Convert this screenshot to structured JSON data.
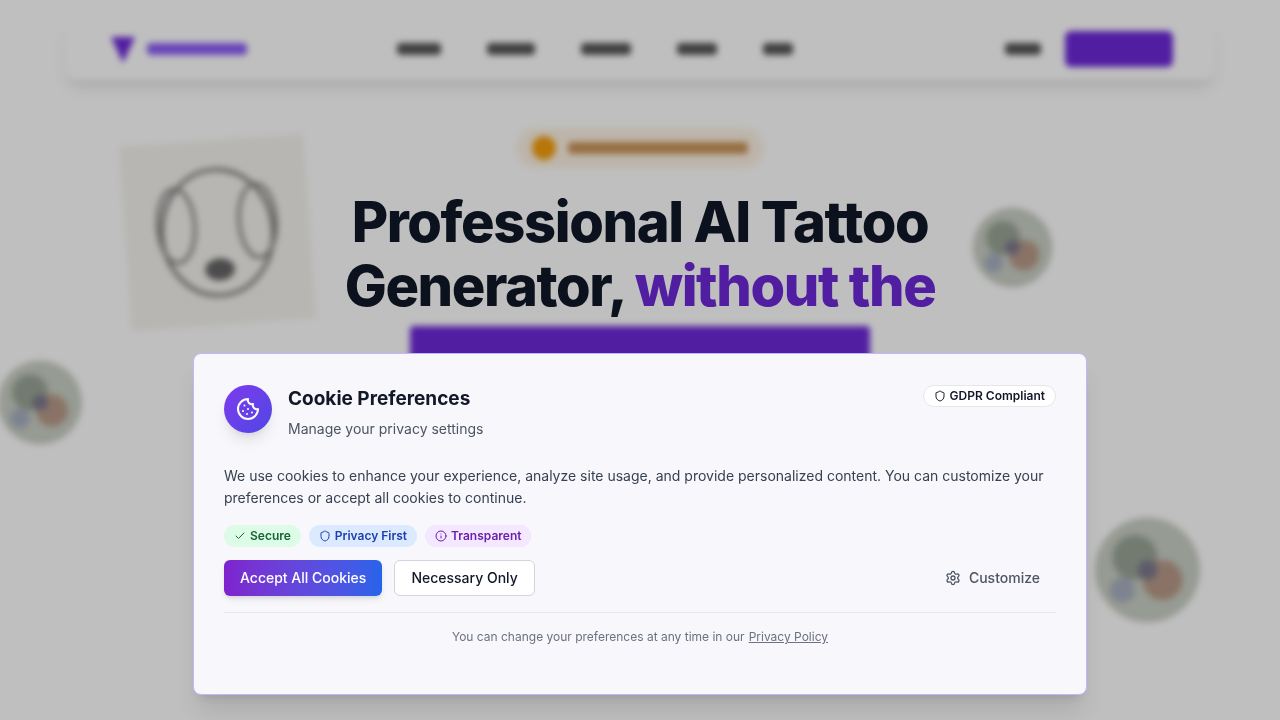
{
  "hero": {
    "headline": "Professional AI Tattoo Generator,",
    "headline_accent": "without the"
  },
  "cookie_dialog": {
    "title": "Cookie Preferences",
    "subtitle": "Manage your privacy settings",
    "compliance_badge": "GDPR Compliant",
    "body": "We use cookies to enhance your experience, analyze site usage, and provide personalized content. You can customize your preferences or accept all cookies to continue.",
    "tags": [
      {
        "kind": "check",
        "label": "Secure",
        "color": "#dcfce7"
      },
      {
        "kind": "shield",
        "label": "Privacy First",
        "color": "#dbeafe"
      },
      {
        "kind": "info",
        "label": "Transparent",
        "color": "#f3e8ff"
      }
    ],
    "accept_button": "Accept All Cookies",
    "necessary_button": "Necessary Only",
    "customize_button": "Customize",
    "footer_text": "You can change your preferences at any time in our",
    "footer_link": "Privacy Policy"
  }
}
